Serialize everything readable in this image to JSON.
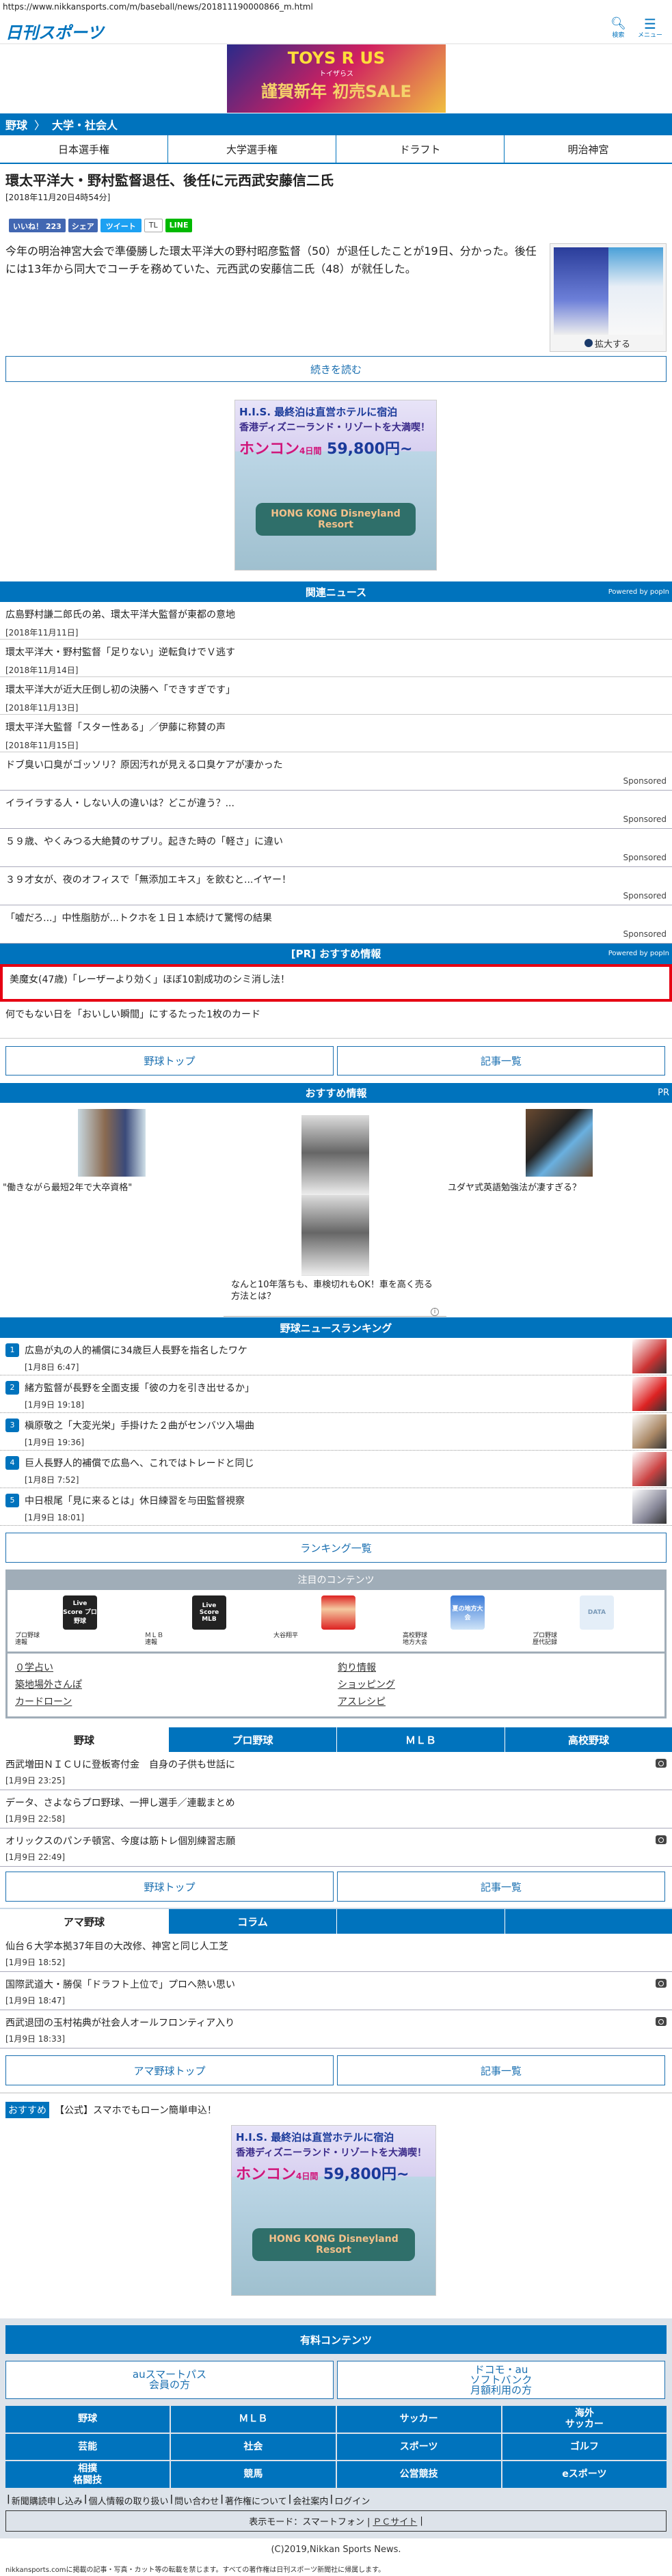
{
  "url": "https://www.nikkansports.com/m/baseball/news/201811190000866_m.html",
  "header": {
    "logo": "日刊スポーツ",
    "search": "検索",
    "menu": "メニュー"
  },
  "top_ad": {
    "brand": "TOYS R US",
    "sub": "トイザらス",
    "text": "謹賀新年 初売SALE"
  },
  "breadcrumb": [
    "野球",
    "大学・社会人"
  ],
  "subnav": [
    "日本選手権",
    "大学選手権",
    "ドラフト",
    "明治神宮"
  ],
  "article": {
    "title": "環太平洋大・野村監督退任、後任に元西武安藤信二氏",
    "date": "[2018年11月20日4時54分]",
    "body": "今年の明治神宮大会で準優勝した環太平洋大の野村昭彦監督（50）が退任したことが19日、分かった。後任には13年から同大でコーチを務めていた、元西武の安藤信二氏（48）が就任した。",
    "enlarge": "拡大する",
    "read_more": "続きを読む"
  },
  "share": {
    "like": "いいね！ 223",
    "share": "シェア",
    "tweet": "ツイート",
    "tl": "TL",
    "line": "LINE"
  },
  "his_ad": {
    "brand": "H.I.S.",
    "l1": "最終泊は直営ホテルに宿泊",
    "l2": "香港ディズニーランド・リゾートを大満喫！",
    "l3": "ホンコン",
    "l3b": "4日間",
    "price": "59,800円~",
    "sign": "HONG KONG Disneyland Resort"
  },
  "related": {
    "title": "関連ニュース",
    "powered": "Powered by popIn",
    "items": [
      {
        "t": "広島野村謙二郎氏の弟、環太平洋大監督が東都の意地",
        "d": "[2018年11月11日]"
      },
      {
        "t": "環太平洋大・野村監督「足りない」逆転負けでＶ逃す",
        "d": "[2018年11月14日]"
      },
      {
        "t": "環太平洋大が近大圧倒し初の決勝へ「できすぎです」",
        "d": "[2018年11月13日]"
      },
      {
        "t": "環太平洋大監督「スター性ある」／伊藤に称賛の声",
        "d": "[2018年11月15日]"
      }
    ],
    "sponsored": [
      "ドブ臭い口臭がゴッソリ？原因汚れが見える口臭ケアが凄かった",
      "イライラする人・しない人の違いは？どこが違う？...",
      "５９歳、やくみつる大絶賛のサプリ。起きた時の「軽さ」に違い",
      "３９才女が、夜のオフィスで「無添加エキス」を飲むと...イヤー！",
      "「嘘だろ...」中性脂肪が...トクホを１日１本続けて驚愕の結果"
    ],
    "sponsored_label": "Sponsored"
  },
  "pr": {
    "title": "[PR] おすすめ情報",
    "powered": "Powered by popIn",
    "items": [
      "美魔女(47歳)「レーザーより効く」ほぼ10割成功のシミ消し法！",
      "何でもない日を「おいしい瞬間」にするたった1枚のカード"
    ]
  },
  "nav1": {
    "left": "野球トップ",
    "right": "記事一覧"
  },
  "recommend": {
    "title": "おすすめ情報",
    "pr": "PR",
    "items": [
      "\"働きながら最短2年で大卒資格\"",
      "なんと10年落ちも、車検切れもOK！車を高く売る方法とは？",
      "ユダヤ式英語勉強法が凄すぎる？"
    ]
  },
  "ranking": {
    "title": "野球ニュースランキング",
    "items": [
      {
        "n": "1",
        "t": "広島が丸の人的補償に34歳巨人長野を指名したワケ",
        "d": "[1月8日 6:47]"
      },
      {
        "n": "2",
        "t": "緒方監督が長野を全面支援「彼の力を引き出せるか」",
        "d": "[1月9日 19:18]"
      },
      {
        "n": "3",
        "t": "槇原敬之「大変光栄」手掛けた２曲がセンバツ入場曲",
        "d": "[1月9日 19:36]"
      },
      {
        "n": "4",
        "t": "巨人長野人的補償で広島へ、これではトレードと同じ",
        "d": "[1月8日 7:52]"
      },
      {
        "n": "5",
        "t": "中日根尾「見に来るとは」休日練習を与田監督視察",
        "d": "[1月9日 18:01]"
      }
    ],
    "more": "ランキング一覧"
  },
  "featured": {
    "title": "注目のコンテンツ",
    "icons": [
      {
        "img": "Live Score プロ野球",
        "label": "プロ野球\n速報"
      },
      {
        "img": "Live Score MLB",
        "label": "ＭＬＢ\n速報"
      },
      {
        "img": "",
        "label": "大谷翔平"
      },
      {
        "img": "夏の地方大会",
        "label": "高校野球\n地方大会"
      },
      {
        "img": "DATA",
        "label": "プロ野球\n歴代記録"
      }
    ],
    "links": [
      "０学占い",
      "釣り情報",
      "築地場外さんぽ",
      "ショッピング",
      "カードローン",
      "アスレシピ"
    ]
  },
  "tabs1": [
    "野球",
    "プロ野球",
    "ＭＬＢ",
    "高校野球"
  ],
  "news1": [
    {
      "t": "西武増田ＮＩＣＵに登板寄付金　自身の子供も世話に",
      "d": "[1月9日 23:25]",
      "cam": true
    },
    {
      "t": "データ、さよならプロ野球、一押し選手／連載まとめ",
      "d": "[1月9日 22:58]",
      "cam": false
    },
    {
      "t": "オリックスのパンチ頓宮、今度は筋トレ個別練習志願",
      "d": "[1月9日 22:49]",
      "cam": true
    }
  ],
  "nav2": {
    "left": "野球トップ",
    "right": "記事一覧"
  },
  "tabs2": [
    "アマ野球",
    "コラム",
    "",
    ""
  ],
  "news2": [
    {
      "t": "仙台６大学本拠37年目の大改修、神宮と同じ人工芝",
      "d": "[1月9日 18:52]",
      "cam": false
    },
    {
      "t": "国際武道大・勝俣「ドラフト上位で」プロへ熱い思い",
      "d": "[1月9日 18:47]",
      "cam": true
    },
    {
      "t": "西武退団の玉村祐典が社会人オールフロンティア入り",
      "d": "[1月9日 18:33]",
      "cam": true
    }
  ],
  "nav3": {
    "left": "アマ野球トップ",
    "right": "記事一覧"
  },
  "promo": {
    "badge": "おすすめ",
    "text": "【公式】スマホでもローン簡単申込！"
  },
  "paid": {
    "title": "有料コンテンツ",
    "left": "auスマートパス\n会員の方",
    "right": "ドコモ・au\nソフトバンク\n月額利用の方"
  },
  "categories": [
    "野球",
    "ＭＬＢ",
    "サッカー",
    "海外\nサッカー",
    "芸能",
    "社会",
    "スポーツ",
    "ゴルフ",
    "相撲\n格闘技",
    "競馬",
    "公営競技",
    "eスポーツ"
  ],
  "footer": {
    "links": [
      "新聞購読申し込み",
      "個人情報の取り扱い",
      "問い合わせ",
      "著作権について",
      "会社案内",
      "ログイン"
    ],
    "mode": "表示モード：スマートフォン |",
    "pc": "ＰＣサイト",
    "mode_end": "|",
    "copyright": "(C)2019,Nikkan Sports News.",
    "notice": "nikkansports.comに掲載の記事・写真・カット等の転載を禁じます。すべての著作権は日刊スポーツ新聞社に帰属します。"
  },
  "colors": {
    "brand": "#0073bd",
    "highlight": "#e60012"
  }
}
